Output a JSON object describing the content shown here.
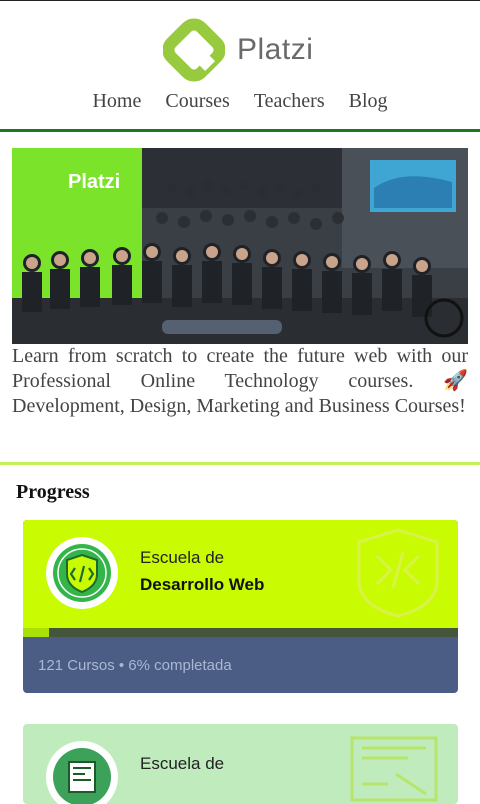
{
  "brand": {
    "name": "Platzi",
    "accent": "#98ca3f"
  },
  "nav": {
    "items": [
      "Home",
      "Courses",
      "Teachers",
      "Blog"
    ]
  },
  "hero": {
    "wall_sign": "Platzi",
    "icons": {
      "rocket": "rocket-icon"
    }
  },
  "intro": {
    "text": "Learn from scratch to create the future web with our Professional Online Technology courses. ",
    "rest": " Development, Design, Marketing and Business Courses!"
  },
  "progress": {
    "title": "Progress",
    "cards": [
      {
        "subtitle": "Escuela de",
        "name": "Desarrollo Web",
        "meta": "121 Cursos • 6% completada",
        "completion": 0.06,
        "color": "#c9fc03"
      },
      {
        "subtitle": "Escuela de",
        "name": "",
        "meta": "",
        "color": "#c0ecbd"
      }
    ]
  }
}
